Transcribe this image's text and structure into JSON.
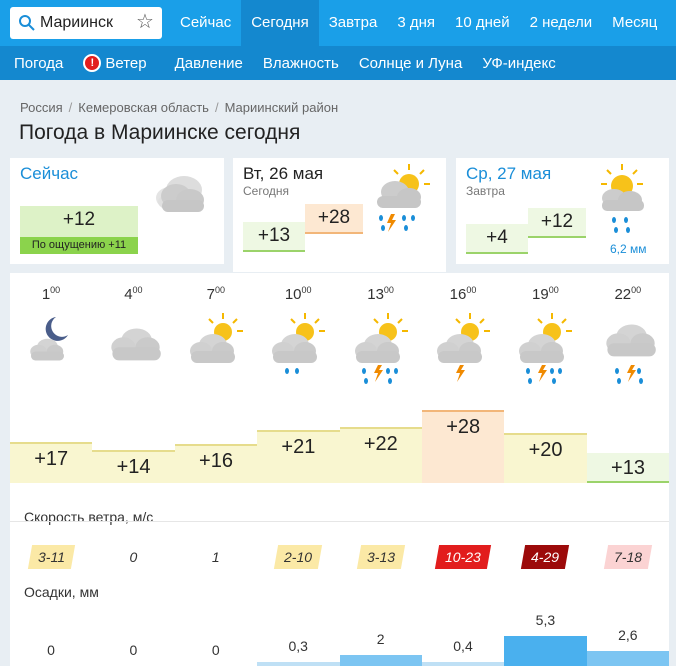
{
  "search": {
    "value": "Мариинск"
  },
  "tabs": [
    {
      "label": "Сейчас"
    },
    {
      "label": "Сегодня"
    },
    {
      "label": "Завтра"
    },
    {
      "label": "3 дня"
    },
    {
      "label": "10 дней"
    },
    {
      "label": "2 недели"
    },
    {
      "label": "Месяц"
    }
  ],
  "subnav": [
    {
      "label": "Погода"
    },
    {
      "label": "Ветер"
    },
    {
      "label": "Давление"
    },
    {
      "label": "Влажность"
    },
    {
      "label": "Солнце и Луна"
    },
    {
      "label": "УФ-индекс"
    }
  ],
  "breadcrumb": [
    "Россия",
    "Кемеровская область",
    "Мариинский район"
  ],
  "page_title": "Погода в Мариинске сегодня",
  "now": {
    "title": "Сейчас",
    "temp": "+12",
    "feels": "По ощущению +11"
  },
  "today": {
    "title": "Вт, 26 мая",
    "sub": "Сегодня",
    "low": "+13",
    "high": "+28"
  },
  "tomorrow": {
    "title": "Ср, 27 мая",
    "sub": "Завтра",
    "low": "+4",
    "high": "+12",
    "precip": "6,2 мм"
  },
  "hours": [
    {
      "h": "1",
      "m": "00",
      "temp": "+17",
      "wind": "3-11",
      "precip": "0",
      "icon": "moon-cloud-icon"
    },
    {
      "h": "4",
      "m": "00",
      "temp": "+14",
      "wind": "0",
      "precip": "0",
      "icon": "cloud-icon"
    },
    {
      "h": "7",
      "m": "00",
      "temp": "+16",
      "wind": "1",
      "precip": "0",
      "icon": "sun-cloud-icon"
    },
    {
      "h": "10",
      "m": "00",
      "temp": "+21",
      "wind": "2-10",
      "precip": "0,3",
      "icon": "sun-cloud-rain-icon"
    },
    {
      "h": "13",
      "m": "00",
      "temp": "+22",
      "wind": "3-13",
      "precip": "2",
      "icon": "sun-cloud-storm-icon"
    },
    {
      "h": "16",
      "m": "00",
      "temp": "+28",
      "wind": "10-23",
      "precip": "0,4",
      "icon": "sun-cloud-lightning-icon"
    },
    {
      "h": "19",
      "m": "00",
      "temp": "+20",
      "wind": "4-29",
      "precip": "5,3",
      "icon": "sun-cloud-storm-icon"
    },
    {
      "h": "22",
      "m": "00",
      "temp": "+13",
      "wind": "7-18",
      "precip": "2,6",
      "icon": "cloud-storm-icon"
    }
  ],
  "labels": {
    "wind": "Скорость ветра, м/с",
    "precip": "Осадки, мм"
  },
  "colors": {
    "topbar": "#1a9fe8",
    "subnav": "#1488cf",
    "active_tab": "#1488cf"
  }
}
